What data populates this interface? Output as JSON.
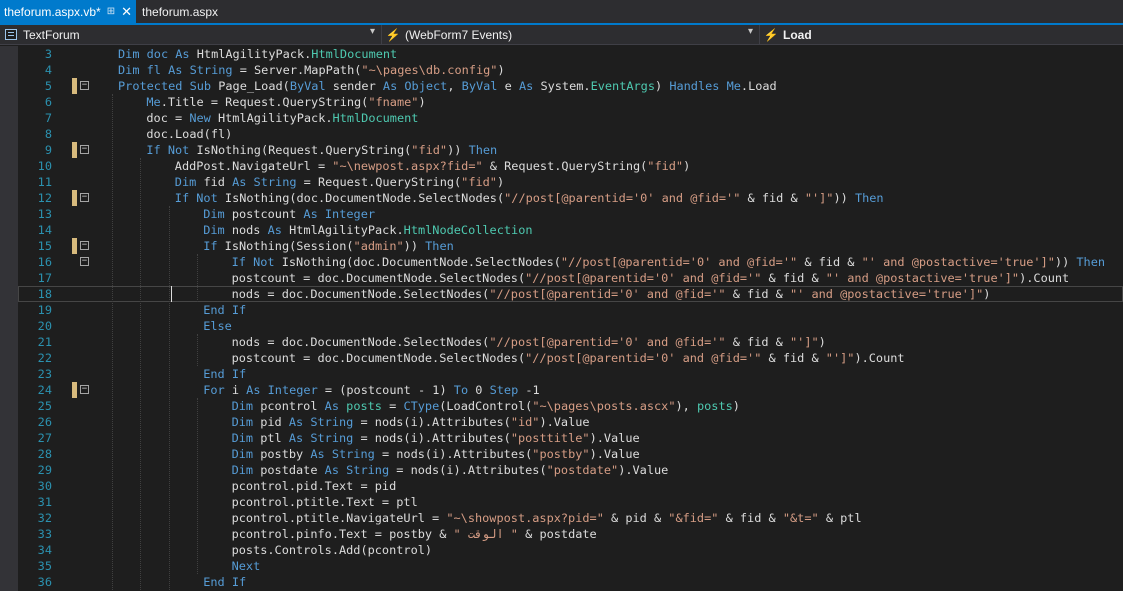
{
  "tabs": [
    {
      "label": "theforum.aspx.vb*",
      "active": true,
      "pin": "⊞",
      "close": "✕"
    },
    {
      "label": "theforum.aspx",
      "active": false
    }
  ],
  "navbar": {
    "project": {
      "label": "TextForum",
      "icon": "vb-file-icon",
      "dropdown": "▾"
    },
    "object": {
      "label": "(WebForm7 Events)",
      "icon": "lightning-icon",
      "dropdown": "▾"
    },
    "member": {
      "label": "Load",
      "icon": "lightning-icon"
    }
  },
  "colors": {
    "accent": "#007acc",
    "keyword": "#569cd6",
    "type": "#4ec9b0",
    "string": "#d69d85",
    "line_number": "#2b91af",
    "change_marker": "#d7ba7d"
  },
  "editor": {
    "current_line": 18,
    "lines": [
      {
        "n": "3",
        "marker": false,
        "fold": false,
        "tokens": [
          [
            "Dim doc As ",
            "k"
          ],
          [
            "HtmlAgilityPack.",
            "p"
          ],
          [
            "HtmlDocument",
            "t"
          ]
        ]
      },
      {
        "n": "4",
        "marker": false,
        "fold": false,
        "tokens": [
          [
            "Dim fl As String",
            "k"
          ],
          [
            " = Server.MapPath(",
            "p"
          ],
          [
            "\"~\\pages\\db.config\"",
            "s"
          ],
          [
            ")",
            "p"
          ]
        ]
      },
      {
        "n": "5",
        "marker": true,
        "fold": true,
        "tokens": [
          [
            "Protected Sub ",
            "k"
          ],
          [
            "Page_Load(",
            "p"
          ],
          [
            "ByVal ",
            "k"
          ],
          [
            "sender ",
            "p"
          ],
          [
            "As Object",
            "k"
          ],
          [
            ", ",
            "p"
          ],
          [
            "ByVal ",
            "k"
          ],
          [
            "e ",
            "p"
          ],
          [
            "As ",
            "k"
          ],
          [
            "System.",
            "p"
          ],
          [
            "EventArgs",
            "t"
          ],
          [
            ") ",
            "p"
          ],
          [
            "Handles Me",
            "k"
          ],
          [
            ".Load",
            "p"
          ]
        ]
      },
      {
        "n": "6",
        "marker": false,
        "fold": false,
        "tokens": [
          [
            "Me",
            "k"
          ],
          [
            ".Title = Request.QueryString(",
            "p"
          ],
          [
            "\"fname\"",
            "s"
          ],
          [
            ")",
            "p"
          ]
        ]
      },
      {
        "n": "7",
        "marker": false,
        "fold": false,
        "tokens": [
          [
            "doc = ",
            "p"
          ],
          [
            "New ",
            "k"
          ],
          [
            "HtmlAgilityPack.",
            "p"
          ],
          [
            "HtmlDocument",
            "t"
          ]
        ]
      },
      {
        "n": "8",
        "marker": false,
        "fold": false,
        "tokens": [
          [
            "doc.Load(fl)",
            "p"
          ]
        ]
      },
      {
        "n": "9",
        "marker": true,
        "fold": true,
        "tokens": [
          [
            "If Not ",
            "k"
          ],
          [
            "IsNothing(Request.QueryString(",
            "p"
          ],
          [
            "\"fid\"",
            "s"
          ],
          [
            ")) ",
            "p"
          ],
          [
            "Then",
            "k"
          ]
        ]
      },
      {
        "n": "10",
        "marker": false,
        "fold": false,
        "tokens": [
          [
            "AddPost.NavigateUrl = ",
            "p"
          ],
          [
            "\"~\\newpost.aspx?fid=\"",
            "s"
          ],
          [
            " & Request.QueryString(",
            "p"
          ],
          [
            "\"fid\"",
            "s"
          ],
          [
            ")",
            "p"
          ]
        ]
      },
      {
        "n": "11",
        "marker": false,
        "fold": false,
        "tokens": [
          [
            "Dim ",
            "k"
          ],
          [
            "fid ",
            "p"
          ],
          [
            "As String",
            "k"
          ],
          [
            " = Request.QueryString(",
            "p"
          ],
          [
            "\"fid\"",
            "s"
          ],
          [
            ")",
            "p"
          ]
        ]
      },
      {
        "n": "12",
        "marker": true,
        "fold": true,
        "tokens": [
          [
            "If Not ",
            "k"
          ],
          [
            "IsNothing(doc.DocumentNode.SelectNodes(",
            "p"
          ],
          [
            "\"//post[@parentid='0' and @fid='\"",
            "s"
          ],
          [
            " & fid & ",
            "p"
          ],
          [
            "\"']\"",
            "s"
          ],
          [
            ")) ",
            "p"
          ],
          [
            "Then",
            "k"
          ]
        ]
      },
      {
        "n": "13",
        "marker": false,
        "fold": false,
        "tokens": [
          [
            "Dim ",
            "k"
          ],
          [
            "postcount ",
            "p"
          ],
          [
            "As Integer",
            "k"
          ]
        ]
      },
      {
        "n": "14",
        "marker": false,
        "fold": false,
        "tokens": [
          [
            "Dim ",
            "k"
          ],
          [
            "nods ",
            "p"
          ],
          [
            "As ",
            "k"
          ],
          [
            "HtmlAgilityPack.",
            "p"
          ],
          [
            "HtmlNodeCollection",
            "t"
          ]
        ]
      },
      {
        "n": "15",
        "marker": true,
        "fold": true,
        "tokens": [
          [
            "If ",
            "k"
          ],
          [
            "IsNothing(Session(",
            "p"
          ],
          [
            "\"admin\"",
            "s"
          ],
          [
            ")) ",
            "p"
          ],
          [
            "Then",
            "k"
          ]
        ]
      },
      {
        "n": "16",
        "marker": false,
        "fold": true,
        "tokens": [
          [
            "If Not ",
            "k"
          ],
          [
            "IsNothing(doc.DocumentNode.SelectNodes(",
            "p"
          ],
          [
            "\"//post[@parentid='0' and @fid='\"",
            "s"
          ],
          [
            " & fid & ",
            "p"
          ],
          [
            "\"' and @postactive='true']\"",
            "s"
          ],
          [
            ")) ",
            "p"
          ],
          [
            "Then",
            "k"
          ]
        ]
      },
      {
        "n": "17",
        "marker": false,
        "fold": false,
        "tokens": [
          [
            "postcount = doc.DocumentNode.SelectNodes(",
            "p"
          ],
          [
            "\"//post[@parentid='0' and @fid='\"",
            "s"
          ],
          [
            " & fid & ",
            "p"
          ],
          [
            "\"' and @postactive='true']\"",
            "s"
          ],
          [
            ").Count",
            "p"
          ]
        ]
      },
      {
        "n": "18",
        "marker": false,
        "fold": false,
        "tokens": [
          [
            "nods = doc.DocumentNode.SelectNodes(",
            "p"
          ],
          [
            "\"//post[@parentid='0' and @fid='\"",
            "s"
          ],
          [
            " & fid & ",
            "p"
          ],
          [
            "\"' and @postactive='true']\"",
            "s"
          ],
          [
            ")",
            "p"
          ]
        ]
      },
      {
        "n": "19",
        "marker": false,
        "fold": false,
        "tokens": [
          [
            "End If",
            "k"
          ]
        ]
      },
      {
        "n": "20",
        "marker": false,
        "fold": false,
        "tokens": [
          [
            "Else",
            "k"
          ]
        ]
      },
      {
        "n": "21",
        "marker": false,
        "fold": false,
        "tokens": [
          [
            "nods = doc.DocumentNode.SelectNodes(",
            "p"
          ],
          [
            "\"//post[@parentid='0' and @fid='\"",
            "s"
          ],
          [
            " & fid & ",
            "p"
          ],
          [
            "\"']\"",
            "s"
          ],
          [
            ")",
            "p"
          ]
        ]
      },
      {
        "n": "22",
        "marker": false,
        "fold": false,
        "tokens": [
          [
            "postcount = doc.DocumentNode.SelectNodes(",
            "p"
          ],
          [
            "\"//post[@parentid='0' and @fid='\"",
            "s"
          ],
          [
            " & fid & ",
            "p"
          ],
          [
            "\"']\"",
            "s"
          ],
          [
            ").Count",
            "p"
          ]
        ]
      },
      {
        "n": "23",
        "marker": false,
        "fold": false,
        "tokens": [
          [
            "End If",
            "k"
          ]
        ]
      },
      {
        "n": "24",
        "marker": true,
        "fold": true,
        "tokens": [
          [
            "For ",
            "k"
          ],
          [
            "i ",
            "p"
          ],
          [
            "As Integer",
            "k"
          ],
          [
            " = (postcount - 1) ",
            "p"
          ],
          [
            "To ",
            "k"
          ],
          [
            "0 ",
            "p"
          ],
          [
            "Step ",
            "k"
          ],
          [
            "-1",
            "p"
          ]
        ]
      },
      {
        "n": "25",
        "marker": false,
        "fold": false,
        "tokens": [
          [
            "Dim ",
            "k"
          ],
          [
            "pcontrol ",
            "p"
          ],
          [
            "As ",
            "k"
          ],
          [
            "posts",
            "t"
          ],
          [
            " = ",
            "p"
          ],
          [
            "CType",
            "k"
          ],
          [
            "(LoadControl(",
            "p"
          ],
          [
            "\"~\\pages\\posts.ascx\"",
            "s"
          ],
          [
            "), ",
            "p"
          ],
          [
            "posts",
            "t"
          ],
          [
            ")",
            "p"
          ]
        ]
      },
      {
        "n": "26",
        "marker": false,
        "fold": false,
        "tokens": [
          [
            "Dim ",
            "k"
          ],
          [
            "pid ",
            "p"
          ],
          [
            "As String",
            "k"
          ],
          [
            " = nods(i).Attributes(",
            "p"
          ],
          [
            "\"id\"",
            "s"
          ],
          [
            ").Value",
            "p"
          ]
        ]
      },
      {
        "n": "27",
        "marker": false,
        "fold": false,
        "tokens": [
          [
            "Dim ",
            "k"
          ],
          [
            "ptl ",
            "p"
          ],
          [
            "As String",
            "k"
          ],
          [
            " = nods(i).Attributes(",
            "p"
          ],
          [
            "\"posttitle\"",
            "s"
          ],
          [
            ").Value",
            "p"
          ]
        ]
      },
      {
        "n": "28",
        "marker": false,
        "fold": false,
        "tokens": [
          [
            "Dim ",
            "k"
          ],
          [
            "postby ",
            "p"
          ],
          [
            "As String",
            "k"
          ],
          [
            " = nods(i).Attributes(",
            "p"
          ],
          [
            "\"postby\"",
            "s"
          ],
          [
            ").Value",
            "p"
          ]
        ]
      },
      {
        "n": "29",
        "marker": false,
        "fold": false,
        "tokens": [
          [
            "Dim ",
            "k"
          ],
          [
            "postdate ",
            "p"
          ],
          [
            "As String",
            "k"
          ],
          [
            " = nods(i).Attributes(",
            "p"
          ],
          [
            "\"postdate\"",
            "s"
          ],
          [
            ").Value",
            "p"
          ]
        ]
      },
      {
        "n": "30",
        "marker": false,
        "fold": false,
        "tokens": [
          [
            "pcontrol.pid.Text = pid",
            "p"
          ]
        ]
      },
      {
        "n": "31",
        "marker": false,
        "fold": false,
        "tokens": [
          [
            "pcontrol.ptitle.Text = ptl",
            "p"
          ]
        ]
      },
      {
        "n": "32",
        "marker": false,
        "fold": false,
        "tokens": [
          [
            "pcontrol.ptitle.NavigateUrl = ",
            "p"
          ],
          [
            "\"~\\showpost.aspx?pid=\"",
            "s"
          ],
          [
            " & pid & ",
            "p"
          ],
          [
            "\"&fid=\"",
            "s"
          ],
          [
            " & fid & ",
            "p"
          ],
          [
            "\"&t=\"",
            "s"
          ],
          [
            " & ptl",
            "p"
          ]
        ]
      },
      {
        "n": "33",
        "marker": false,
        "fold": false,
        "tokens": [
          [
            "pcontrol.pinfo.Text = postby & ",
            "p"
          ],
          [
            "\" الوقت \"",
            "s"
          ],
          [
            " & postdate",
            "p"
          ]
        ]
      },
      {
        "n": "34",
        "marker": false,
        "fold": false,
        "tokens": [
          [
            "posts.Controls.Add(pcontrol)",
            "p"
          ]
        ]
      },
      {
        "n": "35",
        "marker": false,
        "fold": false,
        "tokens": [
          [
            "Next",
            "k"
          ]
        ]
      },
      {
        "n": "36",
        "marker": false,
        "fold": false,
        "tokens": [
          [
            "End If",
            "k"
          ]
        ]
      }
    ]
  }
}
